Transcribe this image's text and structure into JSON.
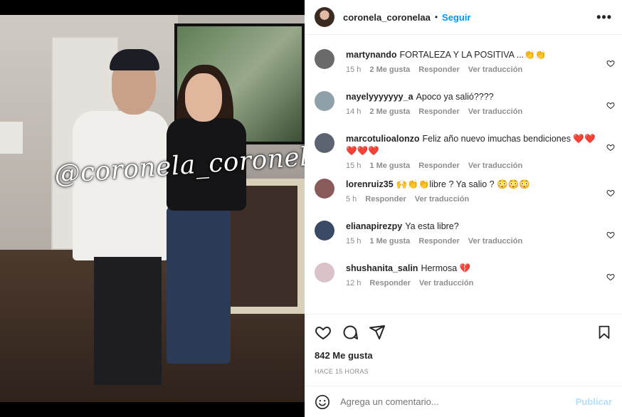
{
  "post": {
    "username": "coronela_coronelaa",
    "separator": "•",
    "follow_label": "Seguir",
    "more_label": "•••",
    "watermark": "@coronela_coronelaa"
  },
  "comments": [
    {
      "user": "martynando",
      "text": "FORTALEZA Y LA POSITIVA ...👏👏",
      "time": "15 h",
      "likes": "2 Me gusta",
      "reply": "Responder",
      "translate": "Ver traducción",
      "avatar_color": "#6a6a6a"
    },
    {
      "user": "nayelyyyyyyy_a",
      "text": "Apoco ya salió????",
      "time": "14 h",
      "likes": "2 Me gusta",
      "reply": "Responder",
      "translate": "Ver traducción",
      "avatar_color": "#8fa0a8"
    },
    {
      "user": "marcotulioalonzo",
      "text": "Feliz año nuevo imuchas bendiciones ❤️❤️❤️❤️❤️",
      "time": "15 h",
      "likes": "1 Me gusta",
      "reply": "Responder",
      "translate": "Ver traducción",
      "avatar_color": "#5b6470"
    },
    {
      "user": "lorenruiz35",
      "text": "🙌👏👏libre ? Ya salio ? 😳😳😳",
      "time": "5 h",
      "likes": "",
      "reply": "Responder",
      "translate": "Ver traducción",
      "avatar_color": "#8a5a5a"
    },
    {
      "user": "elianapirezpy",
      "text": "Ya esta libre?",
      "time": "15 h",
      "likes": "1 Me gusta",
      "reply": "Responder",
      "translate": "Ver traducción",
      "avatar_color": "#3a4a66"
    },
    {
      "user": "shushanita_salin",
      "text": "Hermosa 💔",
      "time": "12 h",
      "likes": "",
      "reply": "Responder",
      "translate": "Ver traducción",
      "avatar_color": "#d9c2c8"
    }
  ],
  "actions": {
    "likes_count": "842 Me gusta",
    "time_ago": "HACE 15 HORAS"
  },
  "composer": {
    "placeholder": "Agrega un comentario...",
    "publish_label": "Publicar"
  },
  "colors": {
    "accent": "#0095f6",
    "publish_disabled": "#b2dffc",
    "text": "#262626",
    "muted": "#8e8e8e"
  }
}
